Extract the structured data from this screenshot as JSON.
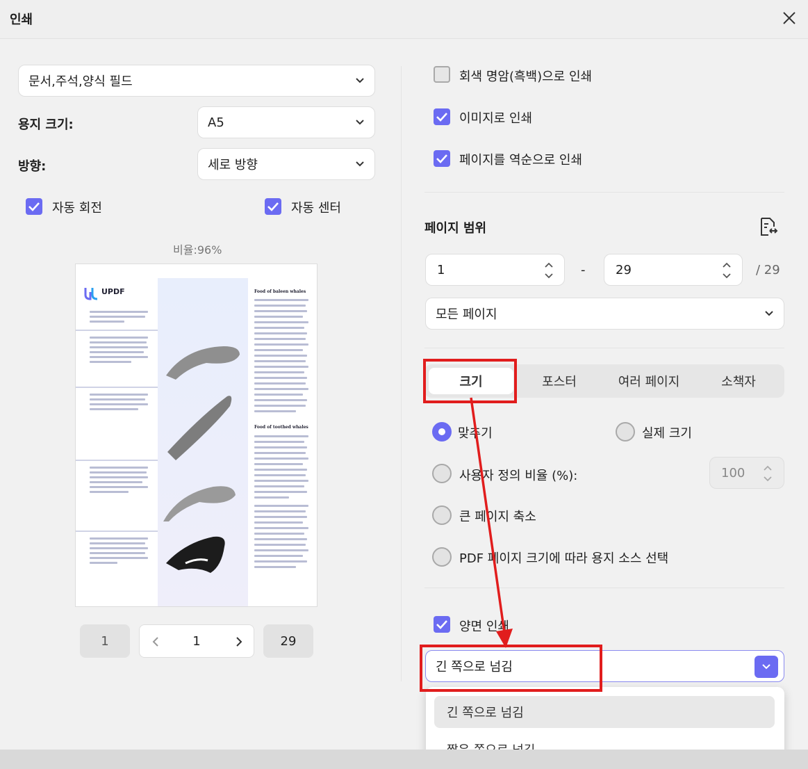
{
  "window": {
    "title": "인쇄"
  },
  "left": {
    "content_select": "문서,주석,양식 필드",
    "paper_size_label": "용지 크기:",
    "paper_size_value": "A5",
    "orientation_label": "방향:",
    "orientation_value": "세로 방향",
    "auto_rotate": "자동 회전",
    "auto_center": "자동 센터",
    "scale_text": "비율:96%",
    "pager": {
      "first": "1",
      "current": "1",
      "last": "29"
    }
  },
  "preview": {
    "brand": "UPDF",
    "heading1": "Food of baleen whales",
    "heading2": "Food of toothed whales"
  },
  "right": {
    "grayscale": "회색 명암(흑백)으로 인쇄",
    "print_as_image": "이미지로 인쇄",
    "reverse_order": "페이지를 역순으로 인쇄",
    "page_range_label": "페이지 범위",
    "range_from": "1",
    "range_dash": "-",
    "range_to": "29",
    "range_total": "/ 29",
    "pages_select": "모든 페이지",
    "tabs": [
      "크기",
      "포스터",
      "여러 페이지",
      "소책자"
    ],
    "fit": "맞추기",
    "actual_size": "실제 크기",
    "custom_scale": "사용자 정의 비율 (%):",
    "custom_scale_value": "100",
    "shrink_large": "큰 페이지 축소",
    "pdf_paper_source": "PDF 페이지 크기에 따라 용지 소스 선택",
    "duplex": "양면 인쇄",
    "flip_select": "긴 쪽으로 넘김",
    "flip_options": [
      "긴 쪽으로 넘김",
      "짧은 쪽으로 넘김"
    ]
  },
  "colors": {
    "accent": "#6b6bf2",
    "annotation": "#e11d1d"
  }
}
